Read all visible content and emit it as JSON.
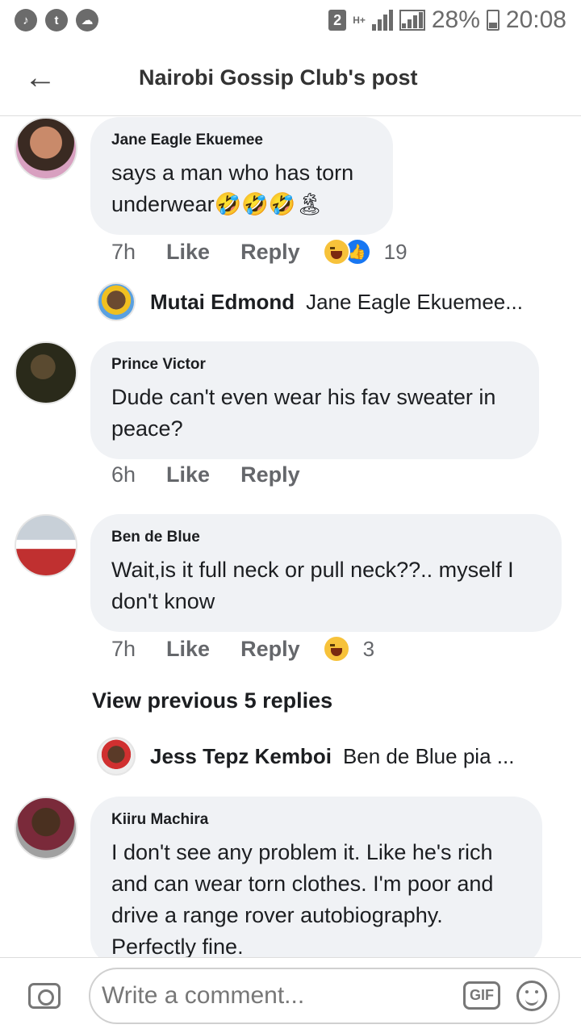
{
  "status_bar": {
    "sim_slot": "2",
    "network": "H+",
    "battery": "28%",
    "time": "20:08",
    "notification_icons": [
      "music-icon",
      "twitter-icon",
      "weather-icon"
    ]
  },
  "header": {
    "title": "Nairobi Gossip Club's post"
  },
  "comments": [
    {
      "author": "Jane Eagle Ekuemee",
      "text": "says a man who has torn underwear🤣🤣🤣🏝",
      "time": "7h",
      "like_label": "Like",
      "reply_label": "Reply",
      "reaction_count": "19"
    },
    {
      "author": "Prince Victor",
      "text": "Dude can't even wear his fav sweater in peace?",
      "time": "6h",
      "like_label": "Like",
      "reply_label": "Reply"
    },
    {
      "author": "Ben de Blue",
      "text": "Wait,is it full neck or pull neck??.. myself I don't know",
      "time": "7h",
      "like_label": "Like",
      "reply_label": "Reply",
      "reaction_count": "3"
    },
    {
      "author": "Kiiru Machira",
      "text": "I don't see any problem it. Like he's rich and can wear torn clothes. I'm poor and drive a range rover autobiography. Perfectly fine."
    }
  ],
  "replies": [
    {
      "author": "Mutai Edmond",
      "text": "Jane Eagle Ekuemee..."
    },
    {
      "author": "Jess Tepz Kemboi",
      "text": "Ben de Blue pia ..."
    }
  ],
  "view_previous": "View previous 5 replies",
  "composer": {
    "placeholder": "Write a comment...",
    "gif_label": "GIF"
  },
  "colors": {
    "bubble": "#f0f2f5",
    "accent_blue": "#1877f2",
    "muted_text": "#65676b"
  }
}
